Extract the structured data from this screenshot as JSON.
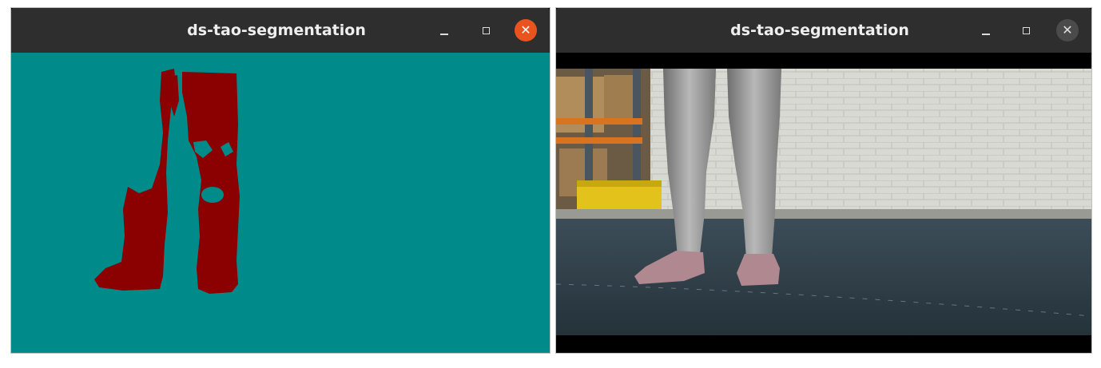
{
  "windows": [
    {
      "title": "ds-tao-segmentation",
      "content": "segmentation-mask",
      "colors": {
        "background": "#008b8b",
        "mask": "#8b0000",
        "close": "#e9541e"
      }
    },
    {
      "title": "ds-tao-segmentation",
      "content": "camera-frame",
      "colors": {
        "close": "#4b4b4b"
      }
    }
  ],
  "icons": {
    "minimize": "minimize-icon",
    "maximize": "maximize-icon",
    "close": "close-icon"
  },
  "controls": {
    "close_glyph": "✕"
  }
}
